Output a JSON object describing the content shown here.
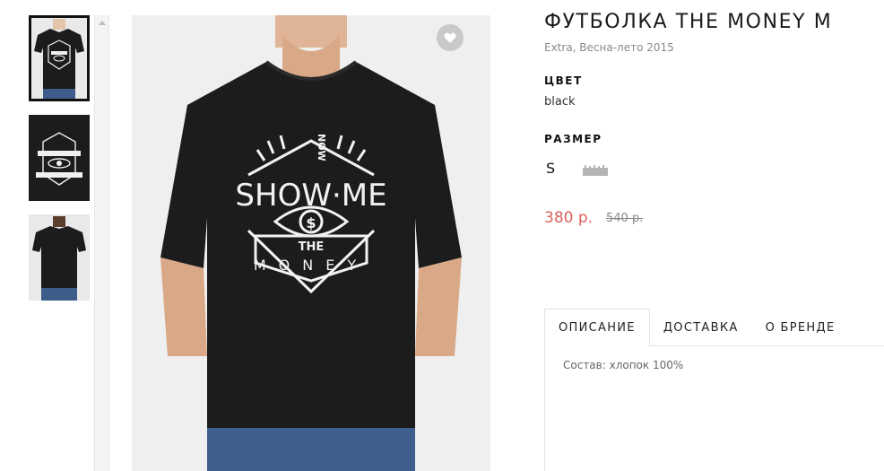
{
  "product": {
    "title": "ФУТБОЛКА THE MONEY M",
    "subtitle": "Extra, Весна-лето 2015",
    "color_label": "ЦВЕТ",
    "color_value": "black",
    "size_label": "РАЗМЕР",
    "sizes": [
      "S"
    ],
    "price": "380 р.",
    "old_price": "540 р."
  },
  "shirt_print": {
    "line1": "NOW",
    "line2": "SHOW·ME",
    "line3": "THE",
    "line4": "MONEY",
    "symbol": "$"
  },
  "tabs": {
    "items": [
      "ОПИСАНИЕ",
      "ДОСТАВКА",
      "О БРЕНДЕ"
    ],
    "active_index": 0,
    "description": "Состав: хлопок 100%"
  },
  "icons": {
    "favorite": "heart-icon",
    "size_chart": "ruler-icon",
    "scroll_up": "arrow-up-icon"
  },
  "colors": {
    "accent_price": "#d9625a",
    "shirt": "#1c1c1c",
    "background": "#efefef"
  }
}
